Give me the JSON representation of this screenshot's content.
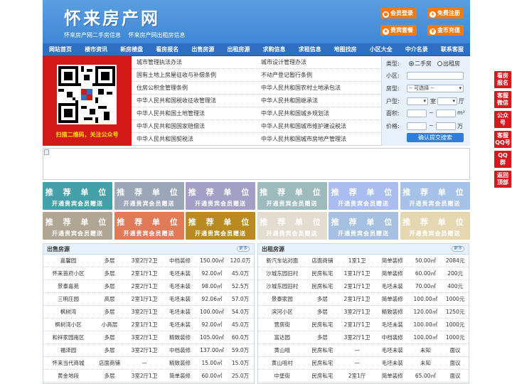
{
  "header": {
    "logo": "怀来房产网",
    "sub_links": [
      "怀来房产网二手房信息",
      "怀来房产网出租房信息"
    ],
    "buttons": [
      {
        "label": "会员登录",
        "icon": "user-icon"
      },
      {
        "label": "免费注册",
        "icon": "register-icon"
      },
      {
        "label": "贵宾套餐",
        "icon": "vip-icon"
      },
      {
        "label": "金币充值",
        "icon": "coin-icon"
      }
    ]
  },
  "nav": [
    "网站首页",
    "楼市资讯",
    "新房楼盘",
    "看房报名",
    "出售房源",
    "出租房源",
    "求购信息",
    "求租信息",
    "地图找房",
    "小区大全",
    "中介名录",
    "联系客服"
  ],
  "qr": {
    "caption": "扫描二维码，关注公众号"
  },
  "law_links": [
    [
      "城市管理执法办法",
      "城市设计管理办法"
    ],
    [
      "国有土地上房屋征收与补偿条例",
      "不动产登记暂行条例"
    ],
    [
      "住房公积金管理条例",
      "中华人民共和国农村土地承包法"
    ],
    [
      "中华人民共和国税收征收管理法",
      "中华人民共和国继承法"
    ],
    [
      "中华人民共和国土地管理法",
      "中华人民共和国城乡规划法"
    ],
    [
      "中华人民共和国国家赔偿法",
      "中华人民共和国城市维护建设税法"
    ],
    [
      "中华人民共和国契税法",
      "中华人民共和国城市房地产管理法"
    ]
  ],
  "search": {
    "type_label": "类型:",
    "type_options": [
      "二手房",
      "出租房"
    ],
    "community_label": "小区:",
    "house_label": "房型:",
    "house_select": "-- 可选择 --",
    "layout_label": "户型:",
    "layout_room": "室",
    "layout_hall": "厅",
    "area_label": "面积:",
    "price_label": "价格:",
    "range_sep": "~",
    "area_unit": "m²",
    "price_unit": "万",
    "submit": "确认提交搜索"
  },
  "ads": {
    "title": "推 荐 单 位",
    "subtitle": "开通贵宾会员赠送",
    "colors": [
      "#46a0a9",
      "#9ba7b9",
      "#a49fc7",
      "#9dbbbd",
      "#a9bdf0",
      "#a6c2e8",
      "#b0a693",
      "#e07a58",
      "#b98a1f",
      "#e3ddd0",
      "#a6c0e1",
      "#e6d7b3"
    ]
  },
  "sale": {
    "title": "出售房源",
    "more": "更多",
    "rows": [
      [
        "嘉馨园",
        "多层",
        "3室2厅2卫",
        "中档装修",
        "150.00㎡",
        "120.0万"
      ],
      [
        "怀来首府小区",
        "多层",
        "2室1厅1卫",
        "毛坯未装",
        "92.00㎡",
        "45.0万"
      ],
      [
        "景泰嘉苑",
        "多层",
        "2室2厅1卫",
        "毛坯未装",
        "98.00㎡",
        "52.5万"
      ],
      [
        "三明庄园",
        "高层",
        "2室1厅1卫",
        "毛坯未装",
        "92.06㎡",
        "57.0万"
      ],
      [
        "枫树湾",
        "多层",
        "3室2厅1卫",
        "毛坯未装",
        "100.00㎡",
        "54.0万"
      ],
      [
        "枫树湾小区",
        "小高层",
        "2室1厅1卫",
        "毛坯未装",
        "92.00㎡",
        "45.0万"
      ],
      [
        "和祥家园南区",
        "多层",
        "3室2厅1卫",
        "精致装修",
        "105.00㎡",
        "60.0万"
      ],
      [
        "福泽园",
        "多层",
        "3室2厅1卫",
        "中档装修",
        "137.00㎡",
        "59.0万"
      ],
      [
        "怀来当代商城",
        "店面商铺",
        "—",
        "精致装修",
        "15.00㎡",
        "15.0万"
      ],
      [
        "黄金地段",
        "多层",
        "3室2厅1卫",
        "简单装修",
        "60.00㎡",
        "25.0万"
      ]
    ]
  },
  "rent": {
    "title": "出租房源",
    "more": "更多",
    "rows": [
      [
        "新汽车站对面",
        "店面商铺",
        "1室1卫",
        "简单装修",
        "50.00㎡",
        "2084元"
      ],
      [
        "沙城东园旧村",
        "民房私宅",
        "1室1厅1卫",
        "简单装修",
        "60.00㎡",
        "200元"
      ],
      [
        "沙城东园旧村",
        "民房私宅",
        "2室1厅1卫",
        "毛坯未装",
        "70.00㎡",
        "400元"
      ],
      [
        "景泰家园",
        "多层",
        "2室1厅1卫",
        "简单装修",
        "100.00㎡",
        "1000元"
      ],
      [
        "滨河小区",
        "多层",
        "3室2厅1卫",
        "精致装修",
        "120.00㎡",
        "1250元"
      ],
      [
        "营房街",
        "民房私宅",
        "2室1厅1卫",
        "毛坯未装",
        "100.00㎡",
        "1000元"
      ],
      [
        "富达园",
        "多层",
        "3室2厅1卫",
        "中档装修",
        "100.00㎡",
        "1000元"
      ],
      [
        "黄山咀",
        "民房私宅",
        "—",
        "毛坯未装",
        "未知",
        "面议"
      ],
      [
        "黄山咀村",
        "民房私宅",
        "—",
        "毛坯未装",
        "未知",
        "面议"
      ],
      [
        "中堡街",
        "民房私宅",
        "2室1厅",
        "简单装修",
        "65.00㎡",
        "面议"
      ]
    ]
  },
  "side": [
    [
      "看房",
      "报名"
    ],
    [
      "客服",
      "微信"
    ],
    [
      "公众",
      "号"
    ],
    [
      "客服",
      "QQ号"
    ],
    [
      "QQ",
      "群"
    ],
    [
      "返回",
      "顶部"
    ]
  ]
}
